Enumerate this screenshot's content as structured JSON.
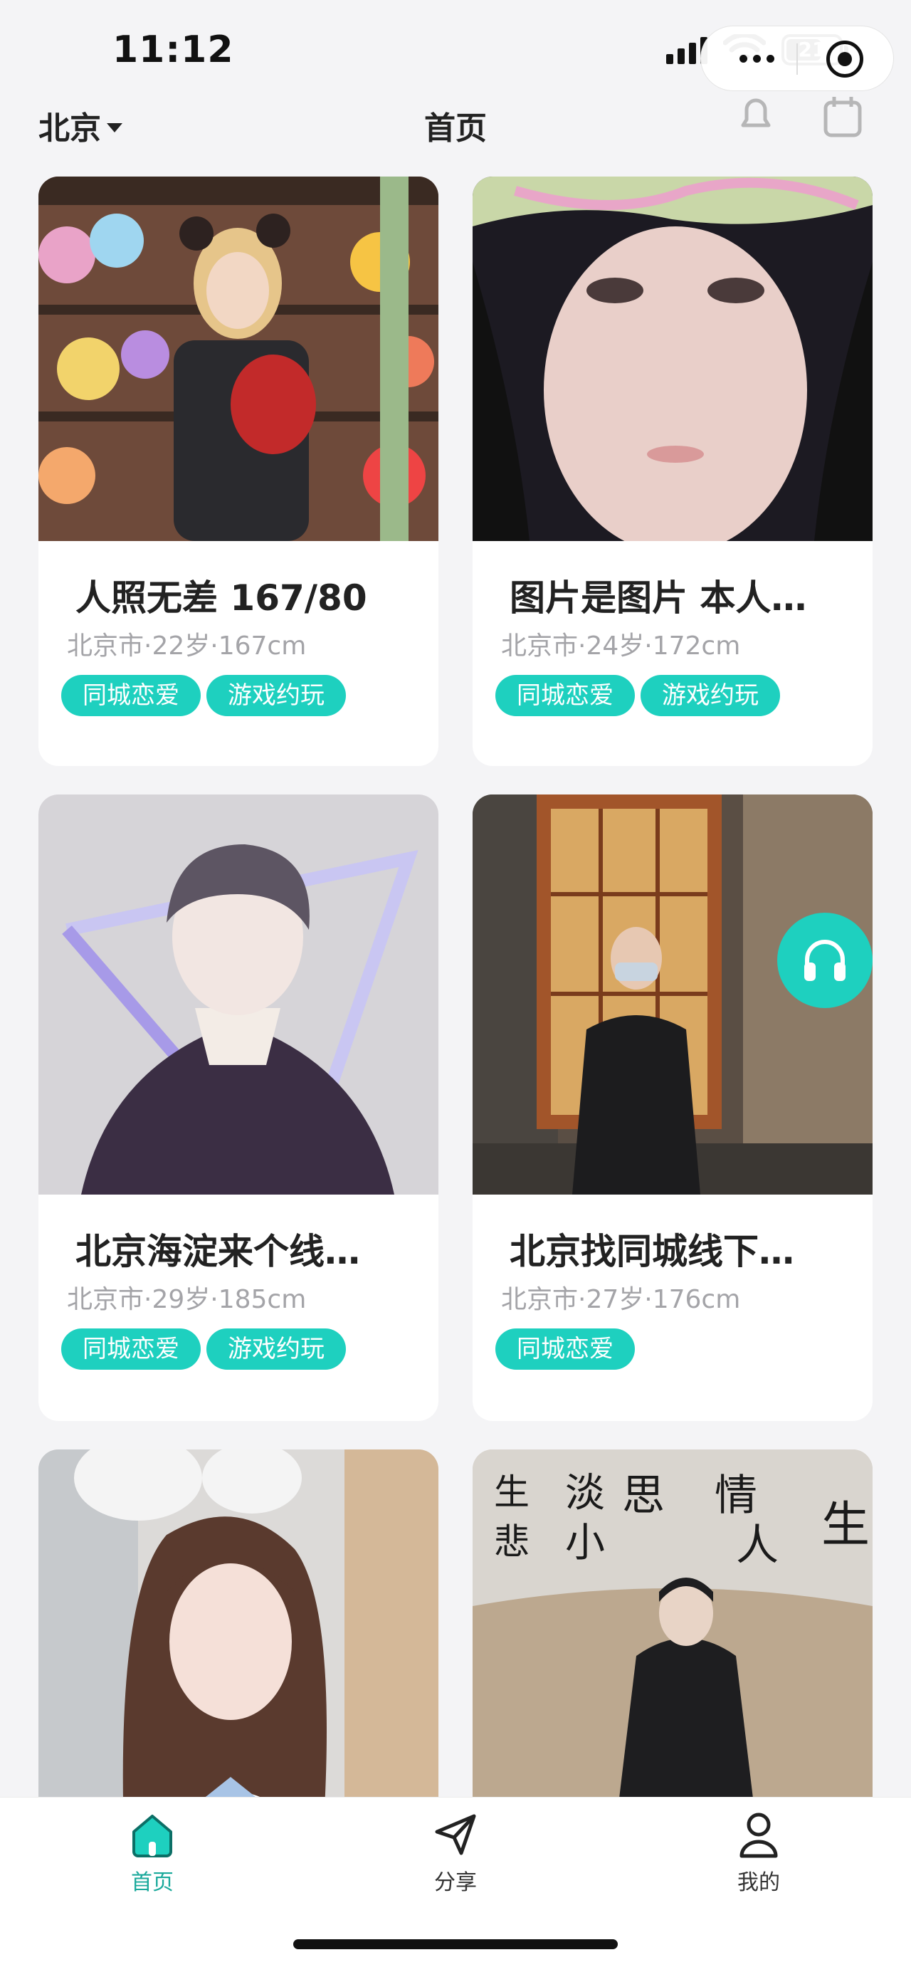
{
  "status_bar": {
    "time": "11:12",
    "battery": "21"
  },
  "header": {
    "city": "北京",
    "title": "首页"
  },
  "colors": {
    "accent": "#1ed0bf",
    "background": "#f4f4f6"
  },
  "cards": [
    {
      "title": "人照无差 167/80",
      "meta": "北京市·22岁·167cm",
      "tags": [
        "同城恋爱",
        "游戏约玩"
      ]
    },
    {
      "title": "图片是图片 本人…",
      "meta": "北京市·24岁·172cm",
      "tags": [
        "同城恋爱",
        "游戏约玩"
      ]
    },
    {
      "title": "北京海淀来个线…",
      "meta": "北京市·29岁·185cm",
      "tags": [
        "同城恋爱",
        "游戏约玩"
      ]
    },
    {
      "title": "北京找同城线下…",
      "meta": "北京市·27岁·176cm",
      "tags": [
        "同城恋爱"
      ]
    },
    {
      "title": "",
      "meta": "",
      "tags": []
    },
    {
      "title": "",
      "meta": "",
      "tags": []
    }
  ],
  "calligraphy": [
    "思",
    "情",
    "人",
    "生",
    "淡",
    "小",
    "生",
    "悲"
  ],
  "tabbar": [
    {
      "label": "首页",
      "icon": "home-icon",
      "active": true
    },
    {
      "label": "分享",
      "icon": "share-icon",
      "active": false
    },
    {
      "label": "我的",
      "icon": "profile-icon",
      "active": false
    }
  ]
}
